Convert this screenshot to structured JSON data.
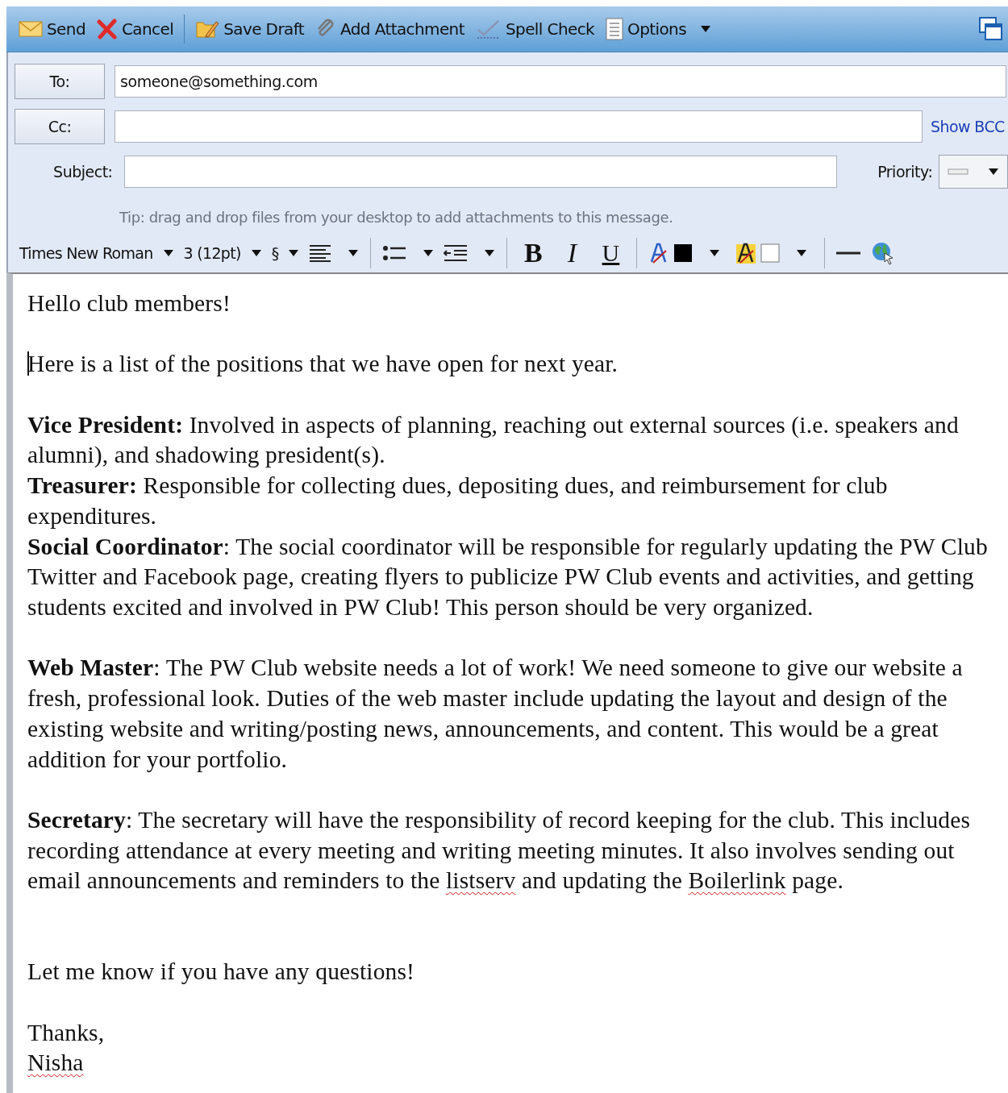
{
  "toolbar": [
    {
      "label": "Send",
      "kind": "send"
    },
    {
      "label": "Cancel",
      "kind": "cancel"
    },
    {
      "label": "Save Draft",
      "kind": "draft"
    },
    {
      "label": "Add Attachment",
      "kind": "attach"
    },
    {
      "label": "Spell Check",
      "kind": "spell"
    },
    {
      "label": "Options",
      "kind": "options"
    }
  ],
  "fields": {
    "to": {
      "label": "To:",
      "value": "someone@something.com"
    },
    "cc": {
      "label": "Cc:"
    },
    "subject": {
      "label": "Subject:"
    },
    "show_bcc": "Show BCC",
    "priority": {
      "label": "Priority:"
    }
  },
  "tip": "Tip: drag and drop files from your desktop to add attachments to this message.",
  "format_toolbar": {
    "font": "Times New Roman",
    "size": "3 (12pt)",
    "paragraph": "§",
    "bold": "B",
    "italic": "I",
    "underline": "U"
  },
  "body": [
    {
      "kind": "first",
      "paragraphs": [
        [
          {
            "text": "Hello club members!"
          }
        ]
      ]
    },
    {
      "kind": "block",
      "caret": true,
      "paragraphs": [
        [
          {
            "text": "Here is a list of the positions that we have open for next year."
          }
        ]
      ]
    },
    {
      "kind": "block",
      "paragraphs": [
        [
          {
            "text": "Vice President:",
            "bold": true
          },
          {
            "text": " Involved in aspects of planning, reaching out external sources (i.e. speakers and alumni), and shadowing president(s)."
          }
        ],
        [
          {
            "text": "Treasurer:",
            "bold": true
          },
          {
            "text": " Responsible for collecting dues, depositing dues, and reimbursement for club expenditures."
          }
        ],
        [
          {
            "text": "Social Coordinator",
            "bold": true
          },
          {
            "text": ": The social coordinator will be responsible for regularly updating the PW Club Twitter and Facebook page, creating flyers to publicize PW Club events and activities, and getting students excited and involved in PW Club! This person should be very organized."
          }
        ]
      ]
    },
    {
      "kind": "block",
      "paragraphs": [
        [
          {
            "text": "Web Master",
            "bold": true
          },
          {
            "text": ": The PW Club website needs a lot of work! We need someone to give our website a fresh, professional look. Duties of the web master include updating the layout and design of the existing website and writing/posting news, announcements, and content. This would be a great addition for your portfolio."
          }
        ]
      ]
    },
    {
      "kind": "block",
      "paragraphs": [
        [
          {
            "text": "Secretary",
            "bold": true
          },
          {
            "text": ": The secretary will have the responsibility of record keeping for the club. This includes recording attendance at every meeting and writing meeting minutes. It also involves sending out email announcements and reminders to the "
          },
          {
            "text": "listserv",
            "misspelled": true
          },
          {
            "text": " and updating the "
          },
          {
            "text": "Boilerlink",
            "misspelled": true
          },
          {
            "text": " page."
          }
        ]
      ]
    },
    {
      "kind": "wide_block",
      "paragraphs": [
        [
          {
            "text": "Let me know if you have any questions!"
          }
        ]
      ]
    },
    {
      "kind": "block",
      "paragraphs": [
        [
          {
            "text": "Thanks,"
          }
        ],
        [
          {
            "text": "Nisha",
            "misspelled": true
          }
        ]
      ]
    }
  ]
}
